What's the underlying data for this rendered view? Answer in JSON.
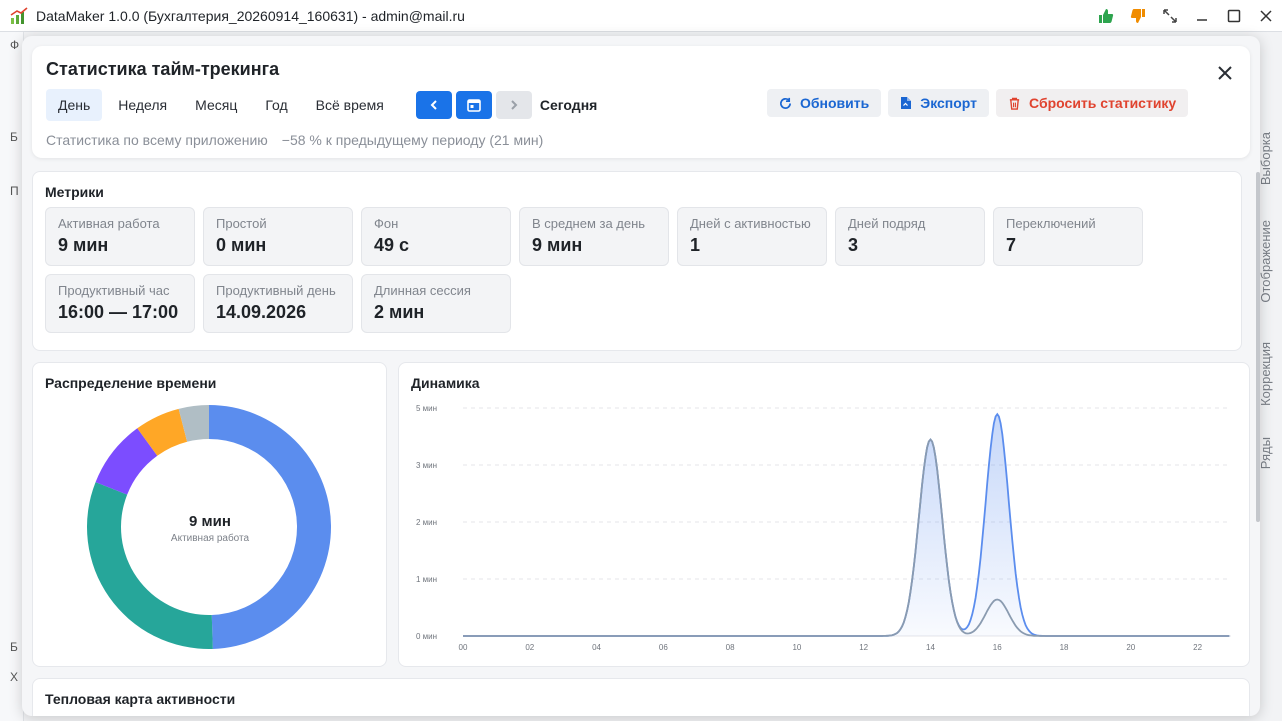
{
  "window": {
    "title": "DataMaker 1.0.0 (Бухгалтерия_20260914_160631) - admin@mail.ru"
  },
  "background": {
    "left_letters": [
      "Ф",
      "Б",
      "П",
      "Б",
      "Х"
    ],
    "right_tabs": [
      "Выборка",
      "Отображение",
      "Коррекция",
      "Ряды"
    ]
  },
  "modal": {
    "title": "Статистика тайм-трекинга",
    "tabs": [
      {
        "label": "День",
        "active": true
      },
      {
        "label": "Неделя",
        "active": false
      },
      {
        "label": "Месяц",
        "active": false
      },
      {
        "label": "Год",
        "active": false
      },
      {
        "label": "Всё время",
        "active": false
      }
    ],
    "period_label": "Сегодня",
    "actions": {
      "refresh": "Обновить",
      "export": "Экспорт",
      "reset": "Сбросить статистику"
    },
    "subtitle": "Статистика по всему приложению",
    "delta": "−58 % к предыдущему периоду (21 мин)"
  },
  "metrics": {
    "title": "Метрики",
    "tiles": [
      {
        "label": "Активная работа",
        "value": "9 мин"
      },
      {
        "label": "Простой",
        "value": "0 мин"
      },
      {
        "label": "Фон",
        "value": "49 с"
      },
      {
        "label": "В среднем за день",
        "value": "9 мин"
      },
      {
        "label": "Дней с активностью",
        "value": "1"
      },
      {
        "label": "Дней подряд",
        "value": "3"
      },
      {
        "label": "Переключений",
        "value": "7"
      },
      {
        "label": "Продуктивный час",
        "value": "16:00 — 17:00"
      },
      {
        "label": "Продуктивный день",
        "value": "14.09.2026"
      },
      {
        "label": "Длинная сессия",
        "value": "2 мин"
      }
    ]
  },
  "distribution": {
    "title": "Распределение времени",
    "center_value": "9 мин",
    "center_label": "Активная работа"
  },
  "dynamics": {
    "title": "Динамика"
  },
  "heatmap": {
    "title": "Тепловая карта активности"
  },
  "colors": {
    "accent": "#1a73e8",
    "danger": "#e0432f",
    "like": "#2da44e",
    "dislike": "#f08c00"
  },
  "chart_data": [
    {
      "type": "pie",
      "variant": "donut",
      "slices": [
        {
          "value": 49.5,
          "color": "#5b8dee"
        },
        {
          "value": 31.5,
          "color": "#26a69a"
        },
        {
          "value": 9,
          "color": "#7c4dff"
        },
        {
          "value": 6,
          "color": "#ffa726"
        },
        {
          "value": 4,
          "color": "#b0bec5"
        }
      ]
    },
    {
      "type": "area",
      "y_tick_labels": [
        "0 мин",
        "1 мин",
        "2 мин",
        "3 мин",
        "4 мин",
        "5 мин"
      ],
      "ylim": [
        0,
        4
      ],
      "x_tick_labels": [
        "00",
        "02",
        "04",
        "06",
        "08",
        "10",
        "12",
        "14",
        "16",
        "18",
        "20",
        "22"
      ],
      "xlim": [
        0,
        23
      ],
      "grid": true,
      "series": [
        {
          "color": "#5b8dee",
          "values": [
            0,
            0,
            0,
            0,
            0,
            0,
            0,
            0,
            0,
            0,
            0,
            0,
            0,
            0,
            3.5,
            0,
            3.95,
            0,
            0,
            0,
            0,
            0,
            0,
            0
          ]
        },
        {
          "color": "#8a9bb0",
          "values": [
            0,
            0,
            0,
            0,
            0,
            0,
            0,
            0,
            0,
            0,
            0,
            0,
            0,
            0,
            3.5,
            0,
            0.65,
            0,
            0,
            0,
            0,
            0,
            0,
            0
          ]
        }
      ]
    }
  ]
}
